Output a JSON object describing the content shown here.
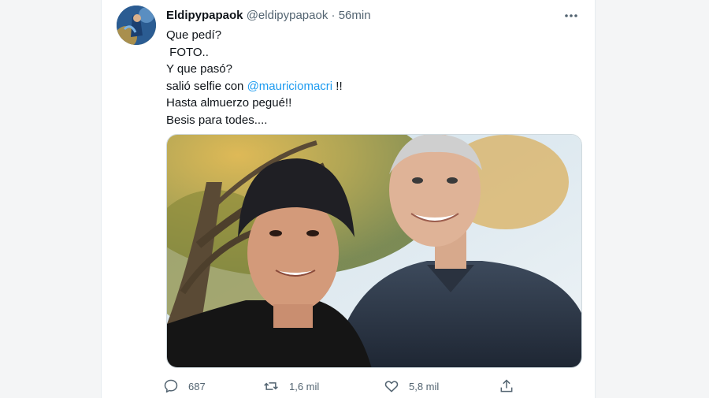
{
  "tweet": {
    "display_name": "Eldipypapaok",
    "handle": "@eldipypapaok",
    "separator": "·",
    "time": "56min",
    "more_icon": "more-horizontal-icon",
    "lines": {
      "l1": "Que pedí?",
      "l2": " FOTO..",
      "l3": "Y que pasó?",
      "l4_pre": "salió selfie con ",
      "l4_mention": "@mauriciomacri",
      "l4_post": " !!",
      "l5": "Hasta almuerzo pegué!!",
      "l6": "Besis para todes...."
    },
    "media_alt": "selfie photo",
    "colors": {
      "mention": "#1d9bf0",
      "secondary_text": "#536471",
      "primary_text": "#0f1419"
    }
  },
  "actions": {
    "reply": {
      "icon": "reply-icon",
      "count": "687"
    },
    "retweet": {
      "icon": "retweet-icon",
      "count": "1,6 mil"
    },
    "like": {
      "icon": "heart-icon",
      "count": "5,8 mil"
    },
    "share": {
      "icon": "share-icon"
    }
  }
}
